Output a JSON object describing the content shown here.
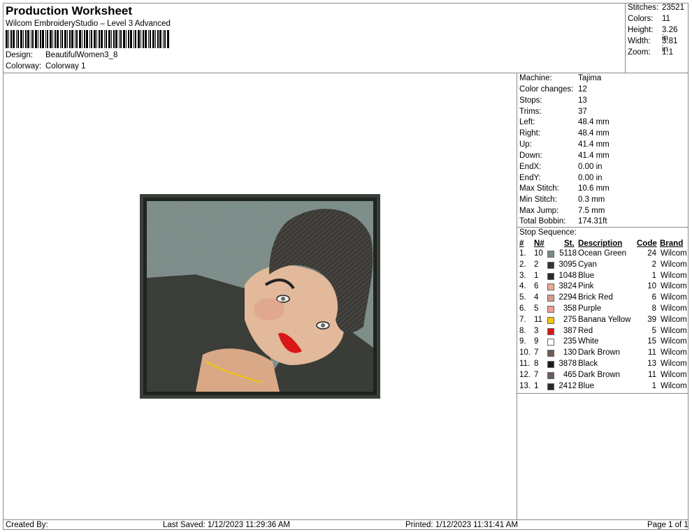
{
  "header": {
    "title": "Production Worksheet",
    "software": "Wilcom EmbroideryStudio – Level 3 Advanced",
    "design_label": "Design:",
    "design_value": "BeautifulWomen3_8",
    "colorway_label": "Colorway:",
    "colorway_value": "Colorway 1"
  },
  "summary": [
    {
      "label": "Stitches:",
      "value": "23521"
    },
    {
      "label": "Colors:",
      "value": "11"
    },
    {
      "label": "Height:",
      "value": "3.26 in"
    },
    {
      "label": "Width:",
      "value": "3.81 in"
    },
    {
      "label": "Zoom:",
      "value": "1:1"
    }
  ],
  "machine_info": [
    {
      "label": "Machine:",
      "value": "Tajima"
    },
    {
      "label": "Color changes:",
      "value": "12"
    },
    {
      "label": "Stops:",
      "value": "13"
    },
    {
      "label": "Trims:",
      "value": "37"
    },
    {
      "label": "Left:",
      "value": "48.4 mm"
    },
    {
      "label": "Right:",
      "value": "48.4 mm"
    },
    {
      "label": "Up:",
      "value": "41.4 mm"
    },
    {
      "label": "Down:",
      "value": "41.4 mm"
    },
    {
      "label": "EndX:",
      "value": "0.00 in"
    },
    {
      "label": "EndY:",
      "value": "0.00 in"
    },
    {
      "label": "Max Stitch:",
      "value": "10.6 mm"
    },
    {
      "label": "Min Stitch:",
      "value": "0.3 mm"
    },
    {
      "label": "Max Jump:",
      "value": "7.5 mm"
    },
    {
      "label": "Total Bobbin:",
      "value": "174.31ft"
    }
  ],
  "stop_sequence": {
    "label": "Stop Sequence:",
    "headers": {
      "num": "#",
      "n": "N#",
      "st": "St.",
      "desc": "Description",
      "code": "Code",
      "brand": "Brand"
    },
    "rows": [
      {
        "num": "1.",
        "n": "10",
        "st": "5118",
        "desc": "Ocean Green",
        "code": "24",
        "brand": "Wilcom",
        "color": "#7d8c8a"
      },
      {
        "num": "2.",
        "n": "2",
        "st": "3095",
        "desc": "Cyan",
        "code": "2",
        "brand": "Wilcom",
        "color": "#333333"
      },
      {
        "num": "3.",
        "n": "1",
        "st": "1048",
        "desc": "Blue",
        "code": "1",
        "brand": "Wilcom",
        "color": "#2a2a2a"
      },
      {
        "num": "4.",
        "n": "6",
        "st": "3824",
        "desc": "Pink",
        "code": "10",
        "brand": "Wilcom",
        "color": "#eaa993"
      },
      {
        "num": "5.",
        "n": "4",
        "st": "2294",
        "desc": "Brick Red",
        "code": "6",
        "brand": "Wilcom",
        "color": "#d49b8a"
      },
      {
        "num": "6.",
        "n": "5",
        "st": "358",
        "desc": "Purple",
        "code": "8",
        "brand": "Wilcom",
        "color": "#ef9e96"
      },
      {
        "num": "7.",
        "n": "11",
        "st": "275",
        "desc": "Banana Yellow",
        "code": "39",
        "brand": "Wilcom",
        "color": "#f2c40a"
      },
      {
        "num": "8.",
        "n": "3",
        "st": "387",
        "desc": "Red",
        "code": "5",
        "brand": "Wilcom",
        "color": "#d81818"
      },
      {
        "num": "9.",
        "n": "9",
        "st": "235",
        "desc": "White",
        "code": "15",
        "brand": "Wilcom",
        "color": "#ffffff"
      },
      {
        "num": "10.",
        "n": "7",
        "st": "130",
        "desc": "Dark Brown",
        "code": "11",
        "brand": "Wilcom",
        "color": "#6b5d55"
      },
      {
        "num": "11.",
        "n": "8",
        "st": "3878",
        "desc": "Black",
        "code": "13",
        "brand": "Wilcom",
        "color": "#1a1a1a"
      },
      {
        "num": "12.",
        "n": "7",
        "st": "465",
        "desc": "Dark Brown",
        "code": "11",
        "brand": "Wilcom",
        "color": "#6b5d55"
      },
      {
        "num": "13.",
        "n": "1",
        "st": "2412",
        "desc": "Blue",
        "code": "1",
        "brand": "Wilcom",
        "color": "#2a2a2a"
      }
    ]
  },
  "footer": {
    "created_by": "Created By:",
    "last_saved": "Last Saved: 1/12/2023 11:29:36 AM",
    "printed": "Printed: 1/12/2023 11:31:41 AM",
    "page": "Page 1 of 1"
  }
}
